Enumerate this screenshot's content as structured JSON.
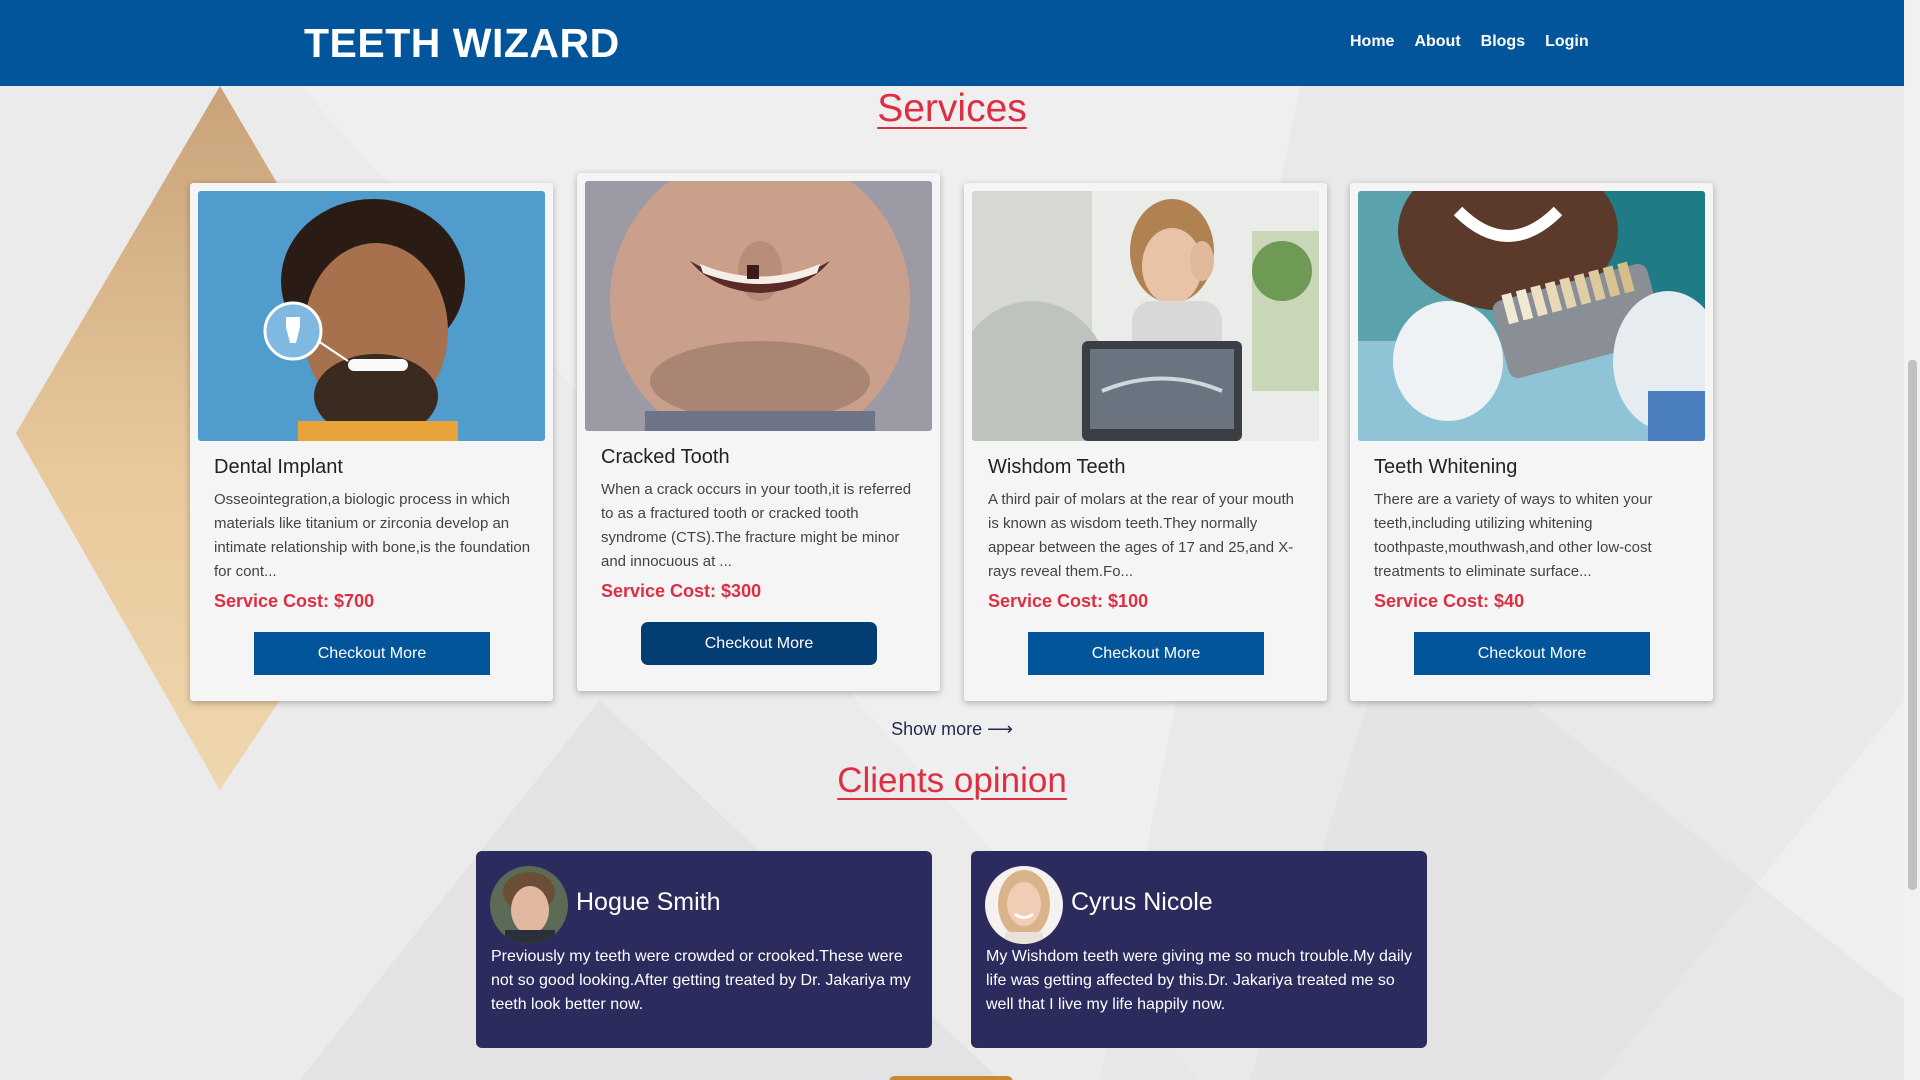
{
  "header": {
    "brand": "TEETH WIZARD",
    "nav": [
      "Home",
      "About",
      "Blogs",
      "Login"
    ]
  },
  "services": {
    "title": "Services",
    "cards": [
      {
        "title": "Dental Implant",
        "description": "Osseointegration,a biologic process in which materials like titanium or zirconia develop an intimate relationship with bone,is the foundation for cont...",
        "cost": "Service Cost: $700",
        "button": "Checkout More"
      },
      {
        "title": "Cracked Tooth",
        "description": "When a crack occurs in your tooth,it is referred to as a fractured tooth or cracked tooth syndrome (CTS).The fracture might be minor and innocuous at ...",
        "cost": "Service Cost: $300",
        "button": "Checkout More"
      },
      {
        "title": "Wishdom Teeth",
        "description": "A third pair of molars at the rear of your mouth is known as wisdom teeth.They normally appear between the ages of 17 and 25,and X-rays reveal them.Fo...",
        "cost": "Service Cost: $100",
        "button": "Checkout More"
      },
      {
        "title": "Teeth Whitening",
        "description": "There are a variety of ways to whiten your teeth,including utilizing whitening toothpaste,mouthwash,and other low-cost treatments to eliminate surface...",
        "cost": "Service Cost: $40",
        "button": "Checkout More"
      }
    ],
    "show_more": "Show more",
    "show_more_arrow": "⟶"
  },
  "clients": {
    "title": "Clients opinion",
    "items": [
      {
        "name": "Hogue Smith",
        "text": "Previously my teeth were crowded or crooked.These were not so good looking.After getting treated by Dr. Jakariya my teeth look better now."
      },
      {
        "name": "Cyrus Nicole",
        "text": "My Wishdom teeth were giving me so much trouble.My daily life was getting affected by this.Dr. Jakariya treated me so well that I live my life happily now."
      }
    ]
  },
  "colors": {
    "navbar": "#02559a",
    "accent_red": "#dd2e44",
    "button_blue": "#02559a",
    "opinion_card": "#2c2b5e"
  }
}
